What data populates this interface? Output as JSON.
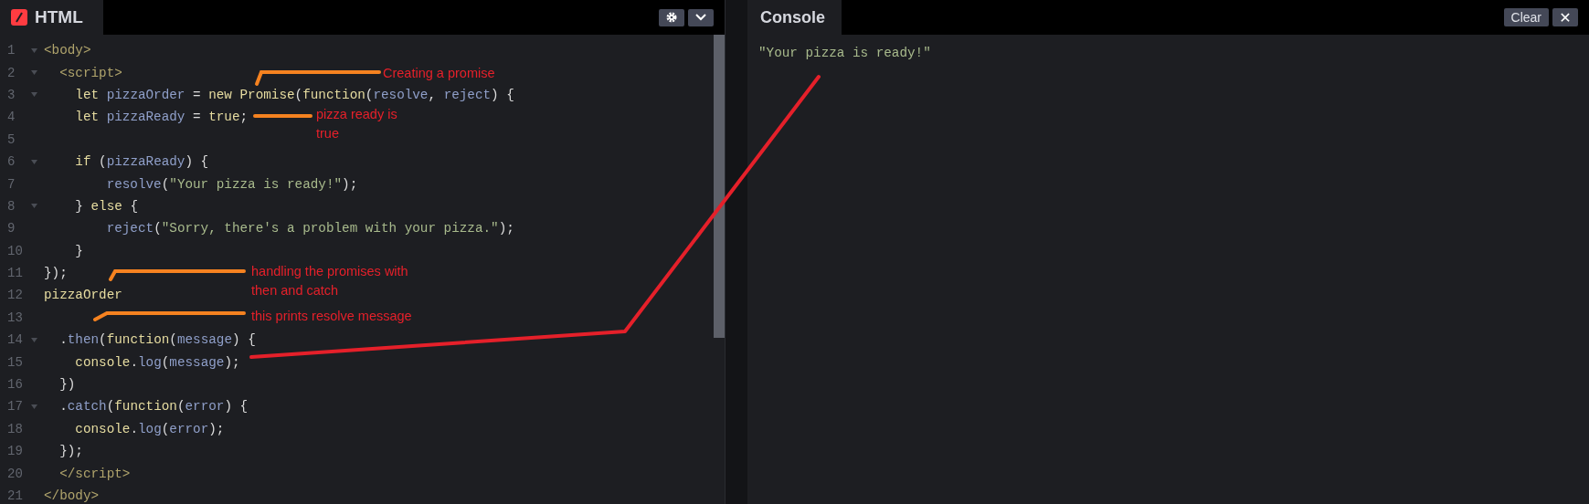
{
  "editor": {
    "tab": {
      "label": "HTML"
    },
    "lines": [
      {
        "number": "1",
        "foldable": true,
        "tokens": [
          {
            "text": "<body>",
            "kind": "tag"
          }
        ]
      },
      {
        "number": "2",
        "foldable": true,
        "tokens": [
          {
            "text": "  <script>",
            "kind": "tag"
          }
        ]
      },
      {
        "number": "3",
        "foldable": true,
        "tokens": [
          {
            "text": "    let ",
            "kind": "keyword"
          },
          {
            "text": "pizzaOrder",
            "kind": "variable"
          },
          {
            "text": " = ",
            "kind": "plain"
          },
          {
            "text": "new Promise",
            "kind": "keyword"
          },
          {
            "text": "(",
            "kind": "plain"
          },
          {
            "text": "function",
            "kind": "keyword"
          },
          {
            "text": "(",
            "kind": "plain"
          },
          {
            "text": "resolve",
            "kind": "variable"
          },
          {
            "text": ", ",
            "kind": "plain"
          },
          {
            "text": "reject",
            "kind": "variable"
          },
          {
            "text": ") {",
            "kind": "plain"
          }
        ]
      },
      {
        "number": "4",
        "foldable": false,
        "tokens": [
          {
            "text": "    let ",
            "kind": "keyword"
          },
          {
            "text": "pizzaReady",
            "kind": "variable"
          },
          {
            "text": " = ",
            "kind": "plain"
          },
          {
            "text": "true",
            "kind": "keyword"
          },
          {
            "text": ";",
            "kind": "plain"
          }
        ]
      },
      {
        "number": "5",
        "foldable": false
      },
      {
        "number": "6",
        "foldable": true,
        "tokens": [
          {
            "text": "    if ",
            "kind": "keyword"
          },
          {
            "text": "(",
            "kind": "plain"
          },
          {
            "text": "pizzaReady",
            "kind": "variable"
          },
          {
            "text": ") {",
            "kind": "plain"
          }
        ]
      },
      {
        "number": "7",
        "foldable": false,
        "tokens": [
          {
            "text": "        resolve",
            "kind": "variable"
          },
          {
            "text": "(",
            "kind": "plain"
          },
          {
            "text": "\"Your pizza is ready!\"",
            "kind": "string"
          },
          {
            "text": ");",
            "kind": "plain"
          }
        ]
      },
      {
        "number": "8",
        "foldable": true,
        "tokens": [
          {
            "text": "    } ",
            "kind": "plain"
          },
          {
            "text": "else",
            "kind": "keyword"
          },
          {
            "text": " {",
            "kind": "plain"
          }
        ]
      },
      {
        "number": "9",
        "foldable": false,
        "tokens": [
          {
            "text": "        reject",
            "kind": "variable"
          },
          {
            "text": "(",
            "kind": "plain"
          },
          {
            "text": "\"Sorry, there's a problem with your pizza.\"",
            "kind": "string"
          },
          {
            "text": ");",
            "kind": "plain"
          }
        ]
      },
      {
        "number": "10",
        "foldable": false,
        "tokens": [
          {
            "text": "    }",
            "kind": "plain"
          }
        ]
      },
      {
        "number": "11",
        "foldable": false,
        "tokens": [
          {
            "text": "});",
            "kind": "plain"
          }
        ]
      },
      {
        "number": "12",
        "foldable": false,
        "tokens": [
          {
            "text": "pizzaOrder",
            "kind": "keyword"
          }
        ]
      },
      {
        "number": "13",
        "foldable": false
      },
      {
        "number": "14",
        "foldable": true,
        "tokens": [
          {
            "text": "  .",
            "kind": "plain"
          },
          {
            "text": "then",
            "kind": "variable"
          },
          {
            "text": "(",
            "kind": "plain"
          },
          {
            "text": "function",
            "kind": "keyword"
          },
          {
            "text": "(",
            "kind": "plain"
          },
          {
            "text": "message",
            "kind": "variable"
          },
          {
            "text": ") {",
            "kind": "plain"
          }
        ]
      },
      {
        "number": "15",
        "foldable": false,
        "tokens": [
          {
            "text": "    console",
            "kind": "keyword"
          },
          {
            "text": ".",
            "kind": "plain"
          },
          {
            "text": "log",
            "kind": "variable"
          },
          {
            "text": "(",
            "kind": "plain"
          },
          {
            "text": "message",
            "kind": "variable"
          },
          {
            "text": ");",
            "kind": "plain"
          }
        ]
      },
      {
        "number": "16",
        "foldable": false,
        "tokens": [
          {
            "text": "  })",
            "kind": "plain"
          }
        ]
      },
      {
        "number": "17",
        "foldable": true,
        "tokens": [
          {
            "text": "  .",
            "kind": "plain"
          },
          {
            "text": "catch",
            "kind": "variable"
          },
          {
            "text": "(",
            "kind": "plain"
          },
          {
            "text": "function",
            "kind": "keyword"
          },
          {
            "text": "(",
            "kind": "plain"
          },
          {
            "text": "error",
            "kind": "variable"
          },
          {
            "text": ") {",
            "kind": "plain"
          }
        ]
      },
      {
        "number": "18",
        "foldable": false,
        "tokens": [
          {
            "text": "    console",
            "kind": "keyword"
          },
          {
            "text": ".",
            "kind": "plain"
          },
          {
            "text": "log",
            "kind": "variable"
          },
          {
            "text": "(",
            "kind": "plain"
          },
          {
            "text": "error",
            "kind": "variable"
          },
          {
            "text": ");",
            "kind": "plain"
          }
        ]
      },
      {
        "number": "19",
        "foldable": false,
        "tokens": [
          {
            "text": "  });",
            "kind": "plain"
          }
        ]
      },
      {
        "number": "20",
        "foldable": false,
        "tokens": [
          {
            "text": "  </script>",
            "kind": "tag"
          }
        ]
      },
      {
        "number": "21",
        "foldable": false,
        "tokens": [
          {
            "text": "</body>",
            "kind": "tag"
          }
        ]
      }
    ]
  },
  "console": {
    "tab": {
      "label": "Console"
    },
    "clear_button": "Clear",
    "close_button": "✕",
    "output": [
      "\"Your pizza is ready!\""
    ]
  },
  "annotations": [
    {
      "lines": [
        "Creating a promise"
      ]
    },
    {
      "lines": [
        "pizza ready is",
        "true"
      ]
    },
    {
      "lines": [
        "handling the promises with",
        "then and catch"
      ]
    },
    {
      "lines": [
        "this prints resolve message"
      ]
    }
  ]
}
